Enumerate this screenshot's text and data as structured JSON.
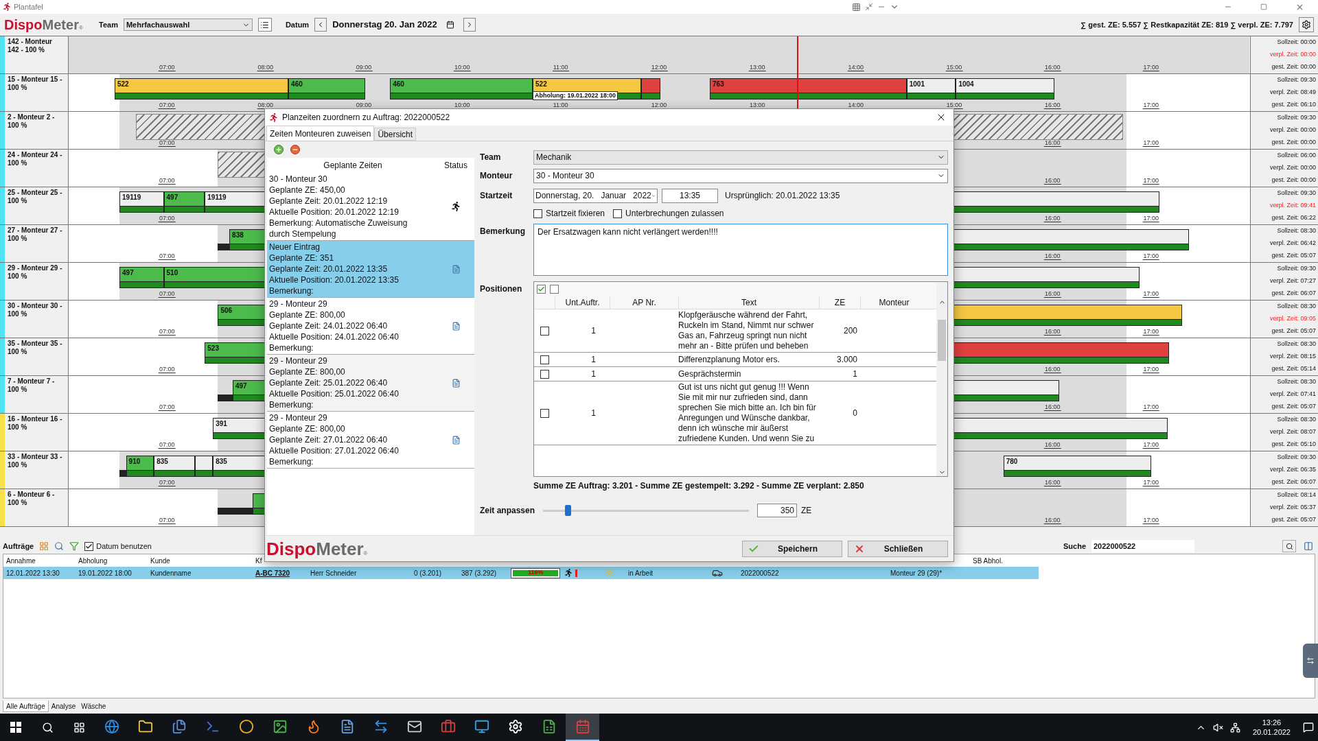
{
  "window": {
    "title": "Plantafel"
  },
  "toolbar": {
    "logo": [
      "Dispo",
      "Meter",
      "®"
    ],
    "team_label": "Team",
    "team_value": "Mehrfachauswahl",
    "date_label": "Datum",
    "date_value": "Donnerstag 20. Jan 2022",
    "totals": "∑ gest. ZE: 5.557 ∑ Restkapazität ZE: 819 ∑ verpl. ZE: 7.797"
  },
  "schedule": {
    "rows": [
      {
        "label": "142 - Monteur\n142 - 100 %",
        "color": "#4de3f0",
        "ticks": [
          "07:00",
          "08:00",
          "09:00",
          "10:00",
          "11:00",
          "12:00",
          "13:00",
          "14:00",
          "15:00",
          "16:00",
          "17:00"
        ],
        "bars": [],
        "summary": [
          "Sollzeit: 00:00",
          "verpl. Zeit: 00:00",
          "gest. Zeit: 00:00"
        ],
        "over": true
      },
      {
        "label": "15 - Monteur 15 -\n100 %",
        "color": "#4de3f0",
        "ticks": [
          "07:00",
          "08:00",
          "09:00",
          "10:00",
          "11:00",
          "12:00",
          "13:00",
          "14:00",
          "15:00",
          "16:00",
          "17:00"
        ],
        "bars": [
          {
            "kind": "bar",
            "text": "522",
            "color": "#f5c842"
          },
          {
            "kind": "bar",
            "text": "460",
            "color": "#4cbb4c"
          },
          {
            "kind": "bar",
            "text": "460",
            "color": "#4cbb4c"
          },
          {
            "kind": "bar",
            "text": "522",
            "color": "#f5c842"
          },
          {
            "kind": "bar",
            "color": "#e04040"
          },
          {
            "kind": "bar",
            "text": "763",
            "color": "#e04040"
          },
          {
            "kind": "bar",
            "text": "1001",
            "color": "#eeeeee"
          },
          {
            "kind": "bar",
            "text": "1004",
            "color": "#eeeeee"
          }
        ],
        "note": "Abholung: 19.01.2022 18:00",
        "summary": [
          "Sollzeit: 09:30",
          "verpl. Zeit: 08:49",
          "gest. Zeit: 06:10"
        ],
        "over": false
      },
      {
        "label": "2 - Monteur 2 -\n100 %",
        "color": "#4de3f0",
        "ticks": [
          "07:00",
          "16:00",
          "17:00"
        ],
        "bars": [
          {
            "kind": "blocked"
          }
        ],
        "summary": [
          "Sollzeit: 09:30",
          "verpl. Zeit: 00:00",
          "gest. Zeit: 00:00"
        ],
        "over": false
      },
      {
        "label": "24 - Monteur 24 -\n100 %",
        "color": "#4de3f0",
        "ticks": [
          "07:00",
          "16:00",
          "17:00"
        ],
        "bars": [
          {
            "kind": "blocked"
          }
        ],
        "summary": [
          "Sollzeit: 06:00",
          "verpl. Zeit: 00:00",
          "gest. Zeit: 00:00"
        ],
        "over": false
      },
      {
        "label": "25 - Monteur 25 -\n100 %",
        "color": "#4de3f0",
        "ticks": [
          "07:00",
          "16:00",
          "17:00"
        ],
        "bars": [
          {
            "kind": "bar",
            "text": "19119",
            "color": "#eeeeee"
          },
          {
            "kind": "bar",
            "text": "497",
            "color": "#4cbb4c"
          },
          {
            "kind": "bar",
            "text": "19119",
            "color": "#eeeeee"
          }
        ],
        "summary": [
          "Sollzeit: 09:30",
          "verpl. Zeit: 09:41",
          "gest. Zeit: 06:22"
        ],
        "over": true
      },
      {
        "label": "27 - Monteur 27 -\n100 %",
        "color": "#4de3f0",
        "ticks": [
          "07:00",
          "16:00",
          "17:00"
        ],
        "bars": [
          {
            "kind": "idle"
          },
          {
            "kind": "bar",
            "text": "838",
            "color": "#4cbb4c"
          },
          {
            "kind": "bar",
            "color": "#eeeeee"
          }
        ],
        "summary": [
          "Sollzeit: 08:30",
          "verpl. Zeit: 06:42",
          "gest. Zeit: 05:07"
        ],
        "over": false
      },
      {
        "label": "29 - Monteur 29 -\n100 %",
        "color": "#4de3f0",
        "ticks": [
          "07:00",
          "16:00",
          "17:00"
        ],
        "bars": [
          {
            "kind": "bar",
            "text": "497",
            "color": "#4cbb4c"
          },
          {
            "kind": "bar",
            "text": "510",
            "color": "#4cbb4c"
          },
          {
            "kind": "bar",
            "color": "#eeeeee"
          }
        ],
        "summary": [
          "Sollzeit: 09:30",
          "verpl. Zeit: 07:27",
          "gest. Zeit: 06:07"
        ],
        "over": false
      },
      {
        "label": "30 - Monteur 30 -\n100 %",
        "color": "#4de3f0",
        "ticks": [
          "07:00",
          "16:00",
          "17:00"
        ],
        "bars": [
          {
            "kind": "bar",
            "text": "506",
            "color": "#4cbb4c"
          },
          {
            "kind": "bar",
            "color": "#f5c842"
          }
        ],
        "summary": [
          "Sollzeit: 08:30",
          "verpl. Zeit: 09:05",
          "gest. Zeit: 05:07"
        ],
        "over": true
      },
      {
        "label": "35 - Monteur 35 -\n100 %",
        "color": "#4de3f0",
        "ticks": [
          "07:00",
          "16:00",
          "17:00"
        ],
        "bars": [
          {
            "kind": "bar",
            "text": "523",
            "color": "#4cbb4c"
          },
          {
            "kind": "bar",
            "color": "#e04040"
          }
        ],
        "summary": [
          "Sollzeit: 08:30",
          "verpl. Zeit: 08:15",
          "gest. Zeit: 05:14"
        ],
        "over": false
      },
      {
        "label": "7 - Monteur 7 -\n100 %",
        "color": "#4de3f0",
        "ticks": [
          "07:00",
          "16:00",
          "17:00"
        ],
        "bars": [
          {
            "kind": "idle"
          },
          {
            "kind": "bar",
            "text": "497",
            "color": "#4cbb4c"
          },
          {
            "kind": "bar",
            "color": "#eeeeee"
          }
        ],
        "summary": [
          "Sollzeit: 08:30",
          "verpl. Zeit: 07:41",
          "gest. Zeit: 05:07"
        ],
        "over": false
      },
      {
        "label": "16 - Monteur 16 -\n100 %",
        "color": "#f7e14a",
        "ticks": [
          "07:00",
          "16:00",
          "17:00"
        ],
        "bars": [
          {
            "kind": "bar",
            "text": "391",
            "color": "#eeeeee"
          }
        ],
        "summary": [
          "Sollzeit: 08:30",
          "verpl. Zeit: 08:07",
          "gest. Zeit: 05:10"
        ],
        "over": false
      },
      {
        "label": "33 - Monteur 33 -\n100 %",
        "color": "#f7e14a",
        "ticks": [
          "07:00",
          "16:00",
          "17:00"
        ],
        "bars": [
          {
            "kind": "idle"
          },
          {
            "kind": "bar",
            "text": "910",
            "color": "#4cbb4c"
          },
          {
            "kind": "bar",
            "text": "835",
            "color": "#eeeeee"
          },
          {
            "kind": "bar",
            "color": "#eeeeee"
          },
          {
            "kind": "bar",
            "text": "835",
            "color": "#eeeeee"
          },
          {
            "kind": "bar",
            "text": "780",
            "color": "#eeeeee"
          }
        ],
        "summary": [
          "Sollzeit: 09:30",
          "verpl. Zeit: 06:35",
          "gest. Zeit: 06:07"
        ],
        "over": false
      },
      {
        "label": "6 - Monteur 6 -\n100 %",
        "color": "#f7e14a",
        "ticks": [
          "07:00",
          "16:00",
          "17:00"
        ],
        "bars": [
          {
            "kind": "idle"
          },
          {
            "kind": "bar",
            "color": "#4cbb4c"
          }
        ],
        "summary": [
          "Sollzeit: 08:14",
          "verpl. Zeit: 05:37",
          "gest. Zeit: 05:07"
        ],
        "over": false
      }
    ]
  },
  "dialog": {
    "title": "Planzeiten zuordnern zu Auftrag: 2022000522",
    "tabs": [
      {
        "label": "Zeiten Monteuren zuweisen",
        "selected": true
      },
      {
        "label": "Übersicht",
        "selected": false
      }
    ],
    "list": {
      "columns": [
        "Geplante Zeiten",
        "Status"
      ],
      "entries": [
        {
          "lines": [
            "30 - Monteur 30",
            "Geplante ZE: 450,00",
            "Geplante Zeit: 20.01.2022 12:19",
            "Aktuelle Position: 20.01.2022 12:19",
            "Bemerkung: Automatische Zuweisung durch Stempelung"
          ],
          "kind": "stamped",
          "selected": false
        },
        {
          "lines": [
            "Neuer Eintrag",
            "Geplante ZE: 351",
            "Geplante Zeit: 20.01.2022 13:35",
            "Aktuelle Position: 20.01.2022 13:35",
            "Bemerkung:"
          ],
          "kind": "document",
          "selected": true
        },
        {
          "lines": [
            "29 - Monteur 29",
            "Geplante ZE: 800,00",
            "Geplante Zeit: 24.01.2022 06:40",
            "Aktuelle Position: 24.01.2022 06:40",
            "Bemerkung:"
          ],
          "kind": "document",
          "selected": false
        },
        {
          "lines": [
            "29 - Monteur 29",
            "Geplante ZE: 800,00",
            "Geplante Zeit: 25.01.2022 06:40",
            "Aktuelle Position: 25.01.2022 06:40",
            "Bemerkung:"
          ],
          "kind": "document",
          "selected": false
        },
        {
          "lines": [
            "29 - Monteur 29",
            "Geplante ZE: 800,00",
            "Geplante Zeit: 27.01.2022 06:40",
            "Aktuelle Position: 27.01.2022 06:40",
            "Bemerkung:"
          ],
          "kind": "document",
          "selected": false
        }
      ]
    },
    "form": {
      "team_label": "Team",
      "team": "Mechanik",
      "monteur_label": "Monteur",
      "monteur": "30 - Monteur 30",
      "start_label": "Startzeit",
      "start_date": "Donnerstag, 20.   Januar   2022",
      "start_time": "13:35",
      "original": "Ursprünglich: 20.01.2022 13:35",
      "options": [
        {
          "label": "Startzeit fixieren",
          "checked": false
        },
        {
          "label": "Unterbrechungen zulassen",
          "checked": false
        }
      ],
      "remark_label": "Bemerkung",
      "remark": "Der Ersatzwagen kann nicht verlängert werden!!!!"
    },
    "positions": {
      "label": "Positionen",
      "columns": [
        "Unt.Auftr.",
        "AP Nr.",
        "Text",
        "ZE",
        "Monteur"
      ],
      "rows": [
        {
          "checked": false,
          "sub": "1",
          "text": "Klopfgeräusche während der Fahrt, Ruckeln im Stand, Nimmt nur schwer Gas an, Fahrzeug springt nun nicht mehr an - Bitte prüfen und beheben",
          "ze": "200"
        },
        {
          "checked": false,
          "sub": "1",
          "text": "Differenzplanung Motor ers.",
          "ze": "3.000"
        },
        {
          "checked": false,
          "sub": "1",
          "text": "Gesprächstermin",
          "ze": "1"
        },
        {
          "checked": false,
          "sub": "1",
          "text": "Gut ist uns nicht gut genug !!! Wenn Sie mit mir nur zufrieden sind, dann sprechen Sie mich bitte an. Ich bin für Anregungen und Wünsche dankbar, denn ich wünsche mir äußerst zufriedene Kunden. Und wenn Sie zu",
          "ze": "0"
        }
      ]
    },
    "sums": "Summe ZE Auftrag: 3.201  -  Summe ZE gestempelt: 3.292  -  Summe ZE verplant: 2.850",
    "adjust": {
      "label": "Zeit anpassen",
      "level": 0.12,
      "value": "350",
      "unit": "ZE"
    },
    "logo": [
      "Dispo",
      "Meter",
      "®"
    ],
    "buttons": [
      {
        "label": "Speichern",
        "kind": "save"
      },
      {
        "label": "Schließen",
        "kind": "close"
      }
    ]
  },
  "orders": {
    "title": "Aufträge",
    "date_filter": {
      "label": "Datum benutzen",
      "checked": true
    },
    "search_label": "Suche",
    "search_value": "2022000522",
    "columns": [
      "Annahme",
      "Abholung",
      "Kunde",
      "Kf"
    ],
    "trailing_column": "SB Abhol.",
    "rows": [
      {
        "selected": true,
        "cells": [
          {
            "kind": "text",
            "text": "12.01.2022 13:30"
          },
          {
            "kind": "text",
            "text": "19.01.2022 18:00"
          },
          {
            "kind": "text",
            "text": "Kundenname"
          },
          {
            "kind": "link",
            "text": "A-BC 7320"
          },
          {
            "kind": "text",
            "text": "Herr Schneider"
          },
          {
            "kind": "text",
            "text": "0 (3.201)"
          },
          {
            "kind": "text",
            "text": "387 (3.292)"
          },
          {
            "kind": "progress",
            "text": "116%",
            "level": 1
          },
          {
            "kind": "status"
          },
          {
            "kind": "sun"
          },
          {
            "kind": "text",
            "text": "in Arbeit"
          },
          {
            "kind": "car"
          },
          {
            "kind": "text",
            "text": "2022000522"
          },
          {
            "kind": "text",
            "text": "Monteur 29 (29)*"
          }
        ]
      }
    ]
  },
  "bottom_tabs": [
    {
      "label": "Alle Aufträge",
      "selected": true
    },
    {
      "label": "Analyse",
      "selected": false
    },
    {
      "label": "Wäsche",
      "selected": false
    }
  ],
  "taskbar": {
    "apps": [
      {
        "kind": "globe",
        "selected": false
      },
      {
        "kind": "folder",
        "selected": false
      },
      {
        "kind": "files",
        "selected": false
      },
      {
        "kind": "terminal",
        "selected": false
      },
      {
        "kind": "circle",
        "selected": false
      },
      {
        "kind": "image",
        "selected": false
      },
      {
        "kind": "flame",
        "selected": false
      },
      {
        "kind": "docs",
        "selected": false
      },
      {
        "kind": "remote",
        "selected": false
      },
      {
        "kind": "mail",
        "selected": false
      },
      {
        "kind": "briefcase",
        "selected": false
      },
      {
        "kind": "monitor",
        "selected": false
      },
      {
        "kind": "gear",
        "selected": false
      },
      {
        "kind": "sheet",
        "selected": false
      },
      {
        "kind": "planner",
        "selected": true
      }
    ],
    "time": "13:26",
    "date": "20.01.2022"
  }
}
